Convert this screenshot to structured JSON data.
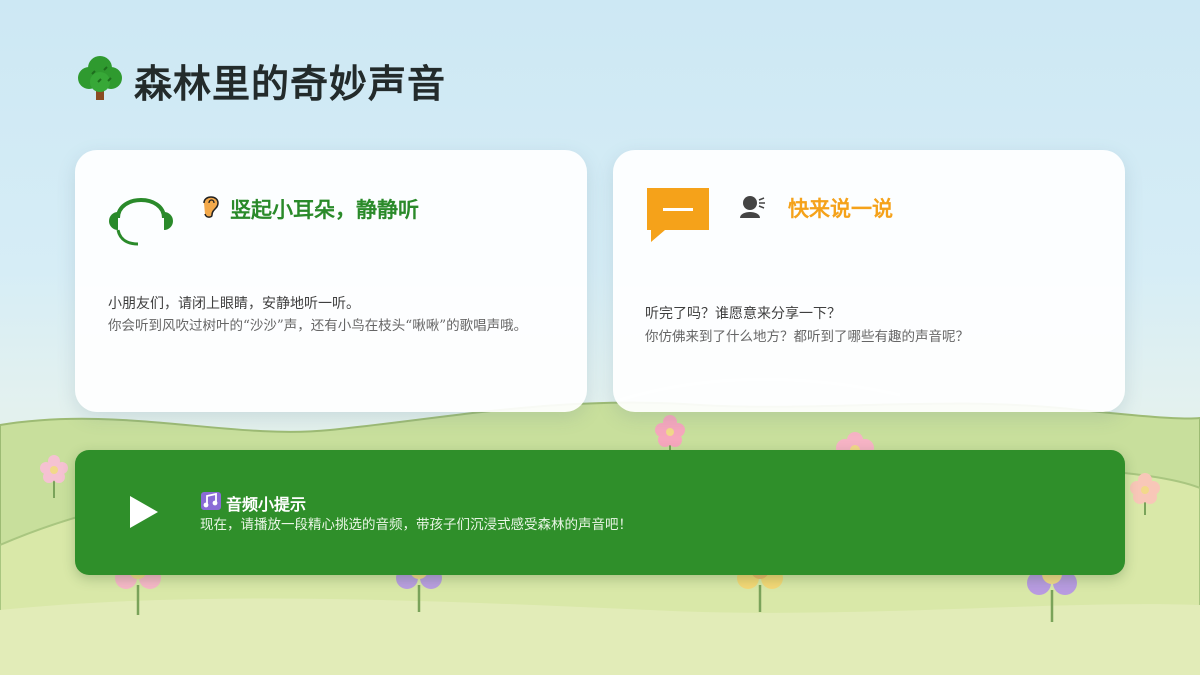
{
  "page": {
    "title": "森林里的奇妙声音",
    "title_icon": "tree-icon"
  },
  "listen_card": {
    "icon": "headphones-icon",
    "heading_icon": "ear-icon",
    "heading": "竖起小耳朵，静静听",
    "lead": "小朋友们，请闭上眼睛，安静地听一听。",
    "detail": "你会听到风吹过树叶的“沙沙”声，还有小鸟在枝头“啾啾”的歌唱声哦。",
    "accent": "#2a8a2a"
  },
  "share_card": {
    "icon": "chat-bubble-icon",
    "heading_icon": "speaking-person-icon",
    "heading": "快来说一说",
    "lead": "听完了吗？谁愿意来分享一下？",
    "detail": "你仿佛来到了什么地方？都听到了哪些有趣的声音呢？",
    "accent": "#f5a21a"
  },
  "audio_tip": {
    "play_icon": "play-icon",
    "heading_icon": "music-note-icon",
    "heading": "音频小提示",
    "text": "现在，请播放一段精心挑选的音频，带孩子们沉浸式感受森林的声音吧！",
    "background": "#2f8f2a"
  }
}
